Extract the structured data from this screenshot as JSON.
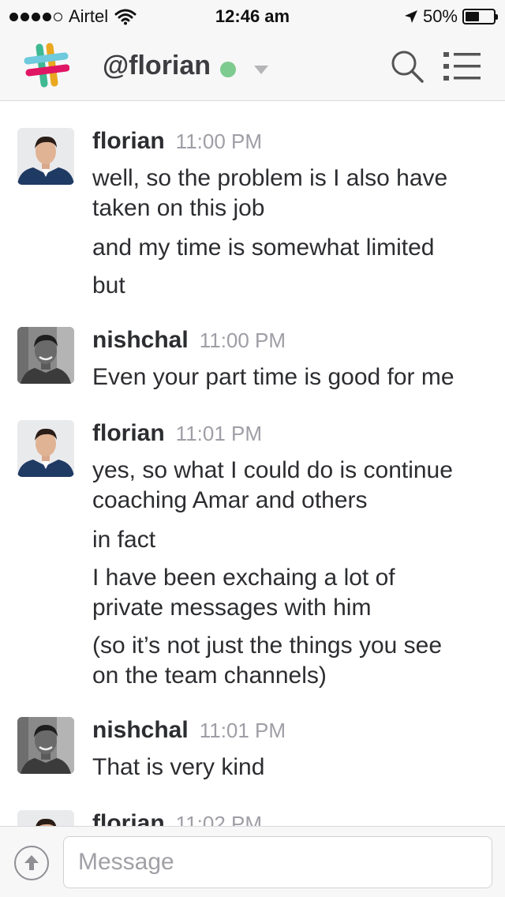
{
  "status_bar": {
    "carrier": "Airtel",
    "time": "12:46 am",
    "battery": "50%",
    "battery_level": 0.5
  },
  "header": {
    "title": "@florian",
    "presence": "active",
    "presence_color": "#7ecb8f"
  },
  "messages": [
    {
      "sender": "florian",
      "time": "11:00 PM",
      "avatar": "photo",
      "lines": [
        "well, so the problem is I also have",
        "taken on this job",
        "and my time is somewhat limited",
        "but"
      ]
    },
    {
      "sender": "nishchal",
      "time": "11:00 PM",
      "avatar": "photo",
      "lines": [
        "Even your part time is good for me"
      ]
    },
    {
      "sender": "florian",
      "time": "11:01 PM",
      "avatar": "photo",
      "lines": [
        "yes, so what I could do is continue",
        "coaching Amar and others",
        "in fact",
        "I have been exchaing a lot of",
        "private messages with him",
        "(so it’s not just the things you see",
        "on the team channels)"
      ]
    },
    {
      "sender": "nishchal",
      "time": "11:01 PM",
      "avatar": "photo",
      "lines": [
        "That is very kind"
      ]
    },
    {
      "sender": "florian",
      "time": "11:02 PM",
      "avatar": "photo",
      "lines": []
    }
  ],
  "composer": {
    "placeholder": "Message"
  },
  "icons": {
    "signal": "signal-dots-icon",
    "wifi": "wifi-icon",
    "location": "location-arrow-icon",
    "battery": "battery-icon",
    "logo": "slack-logo",
    "search": "search-icon",
    "menu": "menu-list-icon",
    "upload": "upload-icon"
  }
}
